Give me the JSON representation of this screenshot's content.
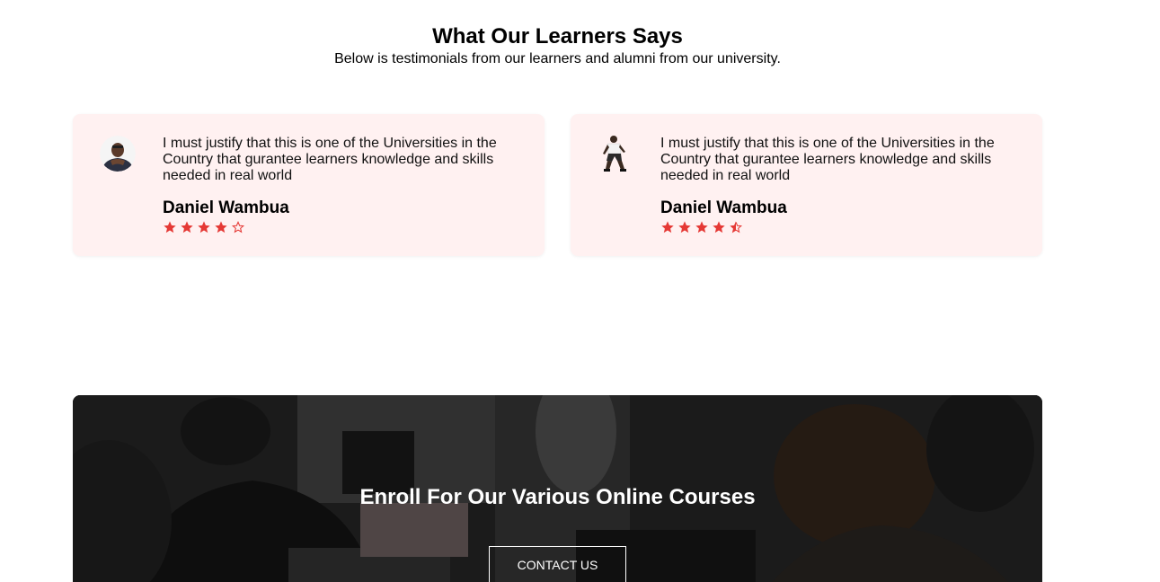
{
  "testimonials_section": {
    "title": "What Our Learners Says",
    "subtitle": "Below is testimonials from our learners and alumni from our university."
  },
  "testimonials": [
    {
      "quote": "I must justify that this is one of the Universities in the Country that gurantee learners knowledge and skills needed in real world",
      "author": "Daniel Wambua",
      "rating": 4,
      "rating_max": 5,
      "stars": [
        "star-filled-icon",
        "star-filled-icon",
        "star-filled-icon",
        "star-filled-icon",
        "star-empty-icon"
      ]
    },
    {
      "quote": "I must justify that this is one of the Universities in the Country that gurantee learners knowledge and skills needed in real world",
      "author": "Daniel Wambua",
      "rating": 4.5,
      "rating_max": 5,
      "stars": [
        "star-filled-icon",
        "star-filled-icon",
        "star-filled-icon",
        "star-filled-icon",
        "star-half-icon"
      ]
    }
  ],
  "cta": {
    "title": "Enroll For Our Various Online Courses",
    "button_label": "CONTACT US"
  },
  "colors": {
    "star": "#e53935",
    "card_background": "#fff1f1",
    "cta_overlay": "#1a1a1a"
  }
}
